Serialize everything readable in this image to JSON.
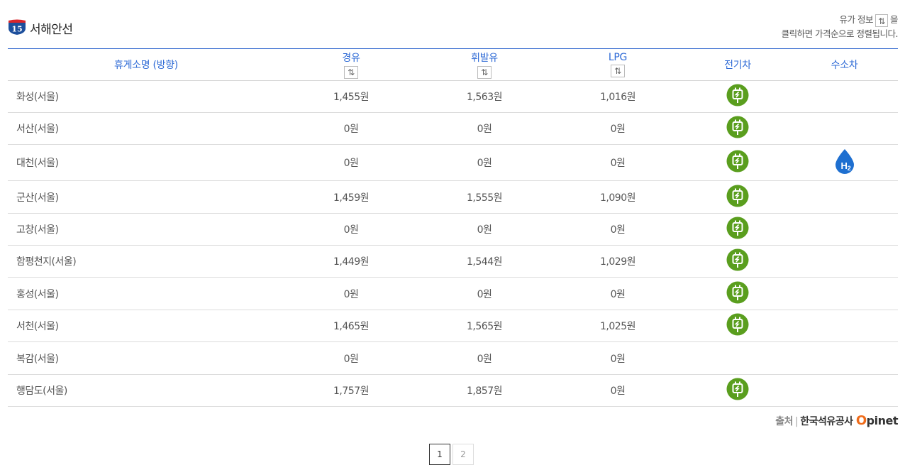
{
  "header": {
    "route_number": "15",
    "route_name": "서해안선",
    "notice_line1_prefix": "유가 정보",
    "notice_line1_suffix": "을",
    "notice_line2": "클릭하면 가격순으로 정렬됩니다.",
    "sort_glyph": "⇅"
  },
  "table": {
    "columns": {
      "name": "휴게소명 (방향)",
      "diesel": "경유",
      "gasoline": "휘발유",
      "lpg": "LPG",
      "ev": "전기차",
      "hydrogen": "수소차"
    },
    "rows": [
      {
        "name": "화성(서울)",
        "diesel": "1,455원",
        "gasoline": "1,563원",
        "lpg": "1,016원",
        "ev": true,
        "h2": false
      },
      {
        "name": "서산(서울)",
        "diesel": "0원",
        "gasoline": "0원",
        "lpg": "0원",
        "ev": true,
        "h2": false
      },
      {
        "name": "대천(서울)",
        "diesel": "0원",
        "gasoline": "0원",
        "lpg": "0원",
        "ev": true,
        "h2": true
      },
      {
        "name": "군산(서울)",
        "diesel": "1,459원",
        "gasoline": "1,555원",
        "lpg": "1,090원",
        "ev": true,
        "h2": false
      },
      {
        "name": "고창(서울)",
        "diesel": "0원",
        "gasoline": "0원",
        "lpg": "0원",
        "ev": true,
        "h2": false
      },
      {
        "name": "함평천지(서울)",
        "diesel": "1,449원",
        "gasoline": "1,544원",
        "lpg": "1,029원",
        "ev": true,
        "h2": false
      },
      {
        "name": "홍성(서울)",
        "diesel": "0원",
        "gasoline": "0원",
        "lpg": "0원",
        "ev": true,
        "h2": false
      },
      {
        "name": "서천(서울)",
        "diesel": "1,465원",
        "gasoline": "1,565원",
        "lpg": "1,025원",
        "ev": true,
        "h2": false
      },
      {
        "name": "복감(서울)",
        "diesel": "0원",
        "gasoline": "0원",
        "lpg": "0원",
        "ev": false,
        "h2": false
      },
      {
        "name": "행담도(서울)",
        "diesel": "1,757원",
        "gasoline": "1,857원",
        "lpg": "0원",
        "ev": true,
        "h2": false
      }
    ]
  },
  "source": {
    "label": "출처",
    "org": "한국석유공사",
    "brand_o": "O",
    "brand_rest": "pinet"
  },
  "pagination": {
    "pages": [
      "1",
      "2"
    ],
    "current": "1"
  },
  "colors": {
    "header_blue": "#2f6bd6",
    "ev_green": "#5a9e1e",
    "h2_blue": "#1e6fd0",
    "brand_orange": "#ef6c1b"
  },
  "icons": {
    "ev": "ev-charger-icon",
    "h2": "hydrogen-icon",
    "route": "highway-route-badge-icon"
  }
}
